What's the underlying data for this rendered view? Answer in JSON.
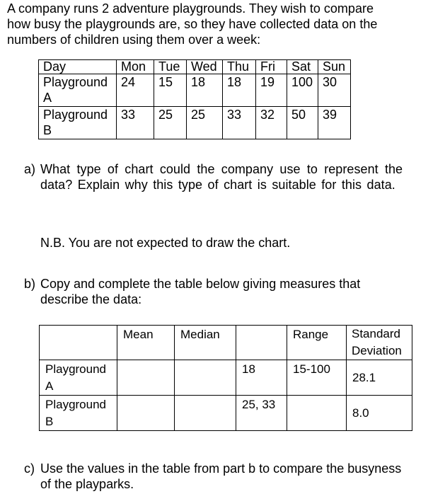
{
  "intro": {
    "lines": [
      "A company runs 2 adventure playgrounds.  They wish to compare",
      "how busy the playgrounds are, so they have collected data on the",
      "numbers of children using them over a week:"
    ]
  },
  "data_table": {
    "header_label": "Day",
    "days": [
      "Mon",
      "Tue",
      "Wed",
      "Thu",
      "Fri",
      "Sat",
      "Sun"
    ],
    "rows": [
      {
        "label_line1": "Playground",
        "label_line2": "A",
        "values": [
          "24",
          "15",
          "18",
          "18",
          "19",
          "100",
          "30"
        ]
      },
      {
        "label_line1": "Playground",
        "label_line2": "B",
        "values": [
          "33",
          "25",
          "25",
          "33",
          "32",
          "50",
          "39"
        ]
      }
    ]
  },
  "question_a": {
    "label": "a)",
    "lines": [
      "What type of chart could the company use to represent the",
      "data?  Explain why this type of chart is suitable for this data."
    ],
    "note": "N.B. You are not expected to draw the chart."
  },
  "question_b": {
    "label": "b)",
    "lines": [
      "Copy and complete the table below giving measures that",
      "describe the data:"
    ]
  },
  "measures_table": {
    "headers": [
      "",
      "Mean",
      "Median",
      "",
      "Range",
      "Standard Deviation"
    ],
    "header_sd_line1": "Standard",
    "header_sd_line2": "Deviation",
    "rows": [
      {
        "label_line1": "Playground",
        "label_line2": "A",
        "mean": "",
        "median": "",
        "blank": "18",
        "range": "15-100",
        "sd": "28.1"
      },
      {
        "label_line1": "Playground",
        "label_line2": "B",
        "mean": "",
        "median": "",
        "blank": "25, 33",
        "range": "",
        "sd": "8.0"
      }
    ]
  },
  "question_c": {
    "label": "c)",
    "lines": [
      "Use the values in the table from part b to compare the busyness",
      "of the playparks."
    ]
  }
}
